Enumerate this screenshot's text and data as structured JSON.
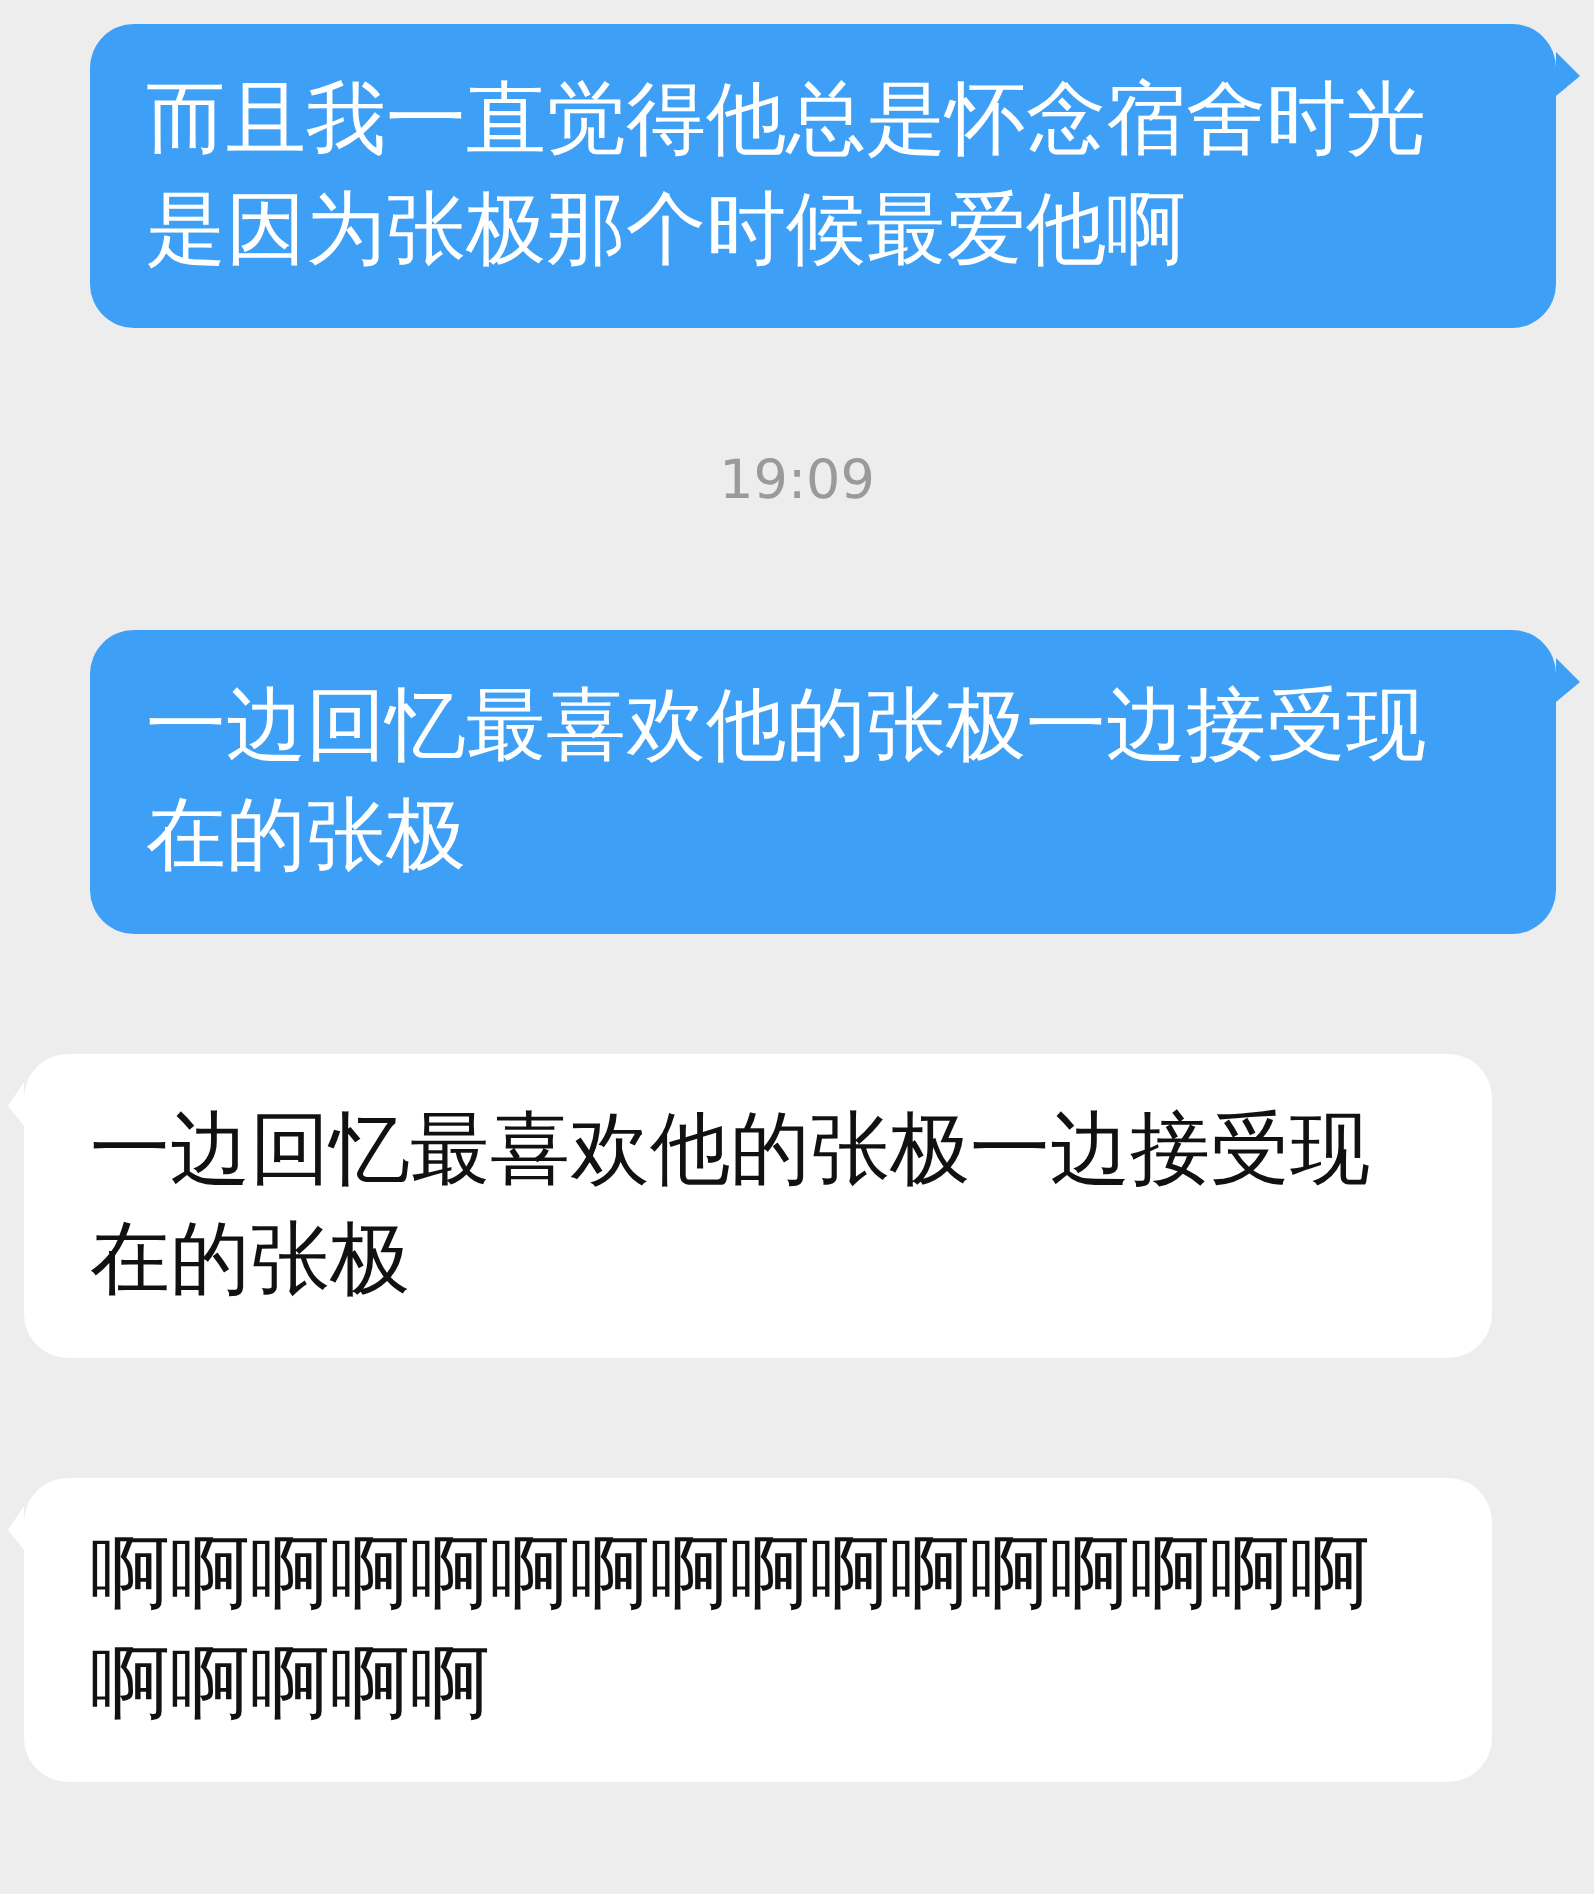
{
  "messages": [
    {
      "kind": "sent",
      "text": "而且我一直觉得他总是怀念宿舍时光是因为张极那个时候最爱他啊"
    },
    {
      "kind": "time",
      "text": "19:09"
    },
    {
      "kind": "sent",
      "text": "一边回忆最喜欢他的张极一边接受现在的张极"
    },
    {
      "kind": "received",
      "text": "一边回忆最喜欢他的张极一边接受现在的张极"
    },
    {
      "kind": "received",
      "text": "啊啊啊啊啊啊啊啊啊啊啊啊啊啊啊啊啊啊啊啊啊"
    }
  ]
}
